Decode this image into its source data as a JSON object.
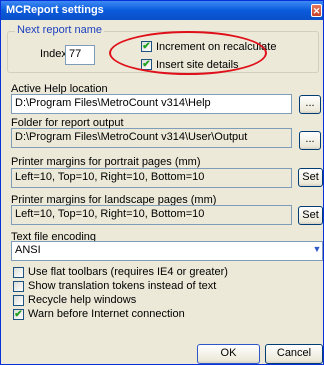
{
  "window": {
    "title": "MCReport settings",
    "close_glyph": "✕"
  },
  "next_report": {
    "group_label": "Next report name",
    "index_label": "Index",
    "index_value": "77",
    "increment_label": "Increment on recalculate",
    "increment_checked": true,
    "insert_site_label": "Insert site details",
    "insert_site_checked": true
  },
  "help_location": {
    "label": "Active Help location",
    "value": "D:\\Program Files\\MetroCount v314\\Help",
    "browse": "..."
  },
  "report_output": {
    "label": "Folder for report output",
    "value": "D:\\Program Files\\MetroCount v314\\User\\Output",
    "browse": "..."
  },
  "portrait": {
    "label": "Printer margins for portrait pages (mm)",
    "value": "Left=10, Top=10, Right=10, Bottom=10",
    "set": "Set"
  },
  "landscape": {
    "label": "Printer margins for landscape pages (mm)",
    "value": "Left=10, Top=10, Right=10, Bottom=10",
    "set": "Set"
  },
  "encoding": {
    "label": "Text file encoding",
    "value": "ANSI",
    "arrow": "▼"
  },
  "options": [
    {
      "label": "Use flat toolbars (requires IE4 or greater)",
      "checked": false
    },
    {
      "label": "Show translation tokens instead of text",
      "checked": false
    },
    {
      "label": "Recycle help windows",
      "checked": false
    },
    {
      "label": "Warn before Internet connection",
      "checked": true
    }
  ],
  "buttons": {
    "ok": "OK",
    "cancel": "Cancel"
  },
  "colors": {
    "title_bar": "#0a5bdb",
    "dialog_bg": "#ece9d8",
    "highlight_oval": "#e0101a",
    "check": "#21a121"
  }
}
